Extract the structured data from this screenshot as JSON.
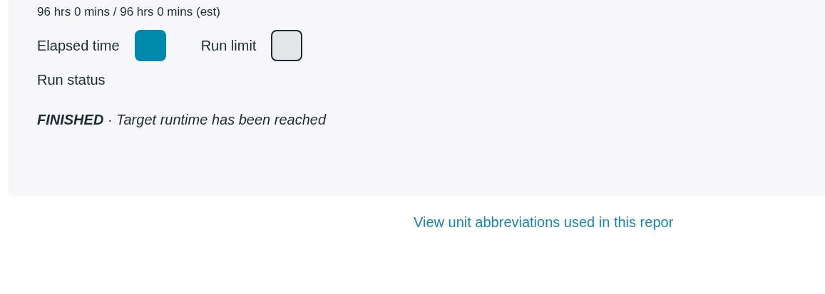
{
  "runtime": "96 hrs 0 mins / 96 hrs 0 mins (est)",
  "legend": [
    {
      "label": "Elapsed time",
      "color": "#0088ad"
    },
    {
      "label": "Run limit",
      "color": "#e4e6e9"
    }
  ],
  "status_label": "Run status",
  "status": "**FINISHED** · Target runtime has been reached",
  "link": "View unit abbreviations used in this repor"
}
